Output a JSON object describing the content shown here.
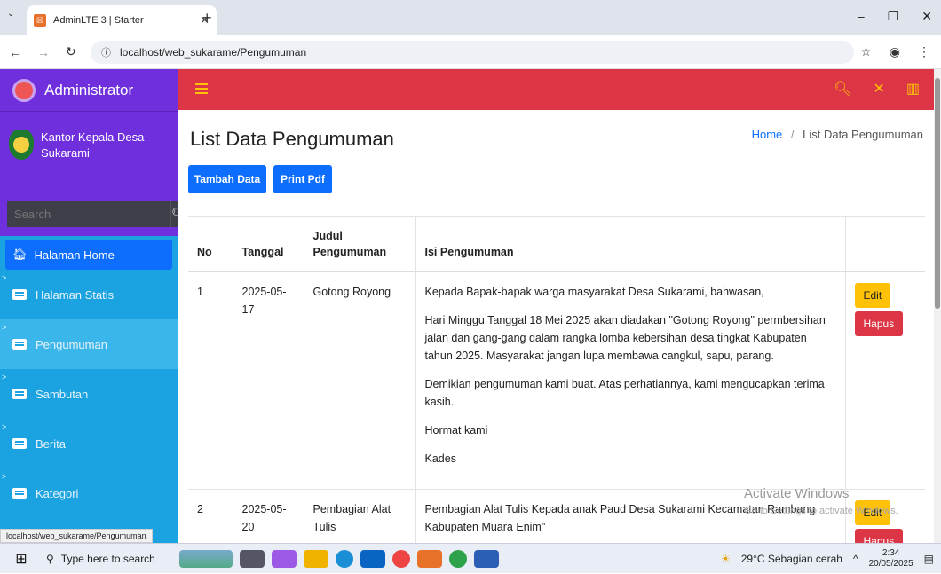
{
  "browser": {
    "tab_title": "AdminLTE 3 | Starter",
    "url": "localhost/web_sukarame/Pengumuman",
    "status_url": "localhost/web_sukarame/Pengumuman"
  },
  "sidebar": {
    "brand": "Administrator",
    "user": "Kantor Kepala Desa Sukarami",
    "search_placeholder": "Search",
    "items": [
      {
        "label": "Halaman Home",
        "icon": "home-icon"
      },
      {
        "label": "Halaman Statis",
        "icon": "list-icon"
      },
      {
        "label": "Pengumuman",
        "icon": "list-icon"
      },
      {
        "label": "Sambutan",
        "icon": "list-icon"
      },
      {
        "label": "Berita",
        "icon": "list-icon"
      },
      {
        "label": "Kategori",
        "icon": "list-icon"
      }
    ]
  },
  "page": {
    "title": "List Data Pengumuman",
    "breadcrumb_home": "Home",
    "breadcrumb_sep": "/",
    "breadcrumb_current": "List Data Pengumuman",
    "btn_add": "Tambah Data",
    "btn_print": "Print Pdf"
  },
  "table": {
    "headers": [
      "No",
      "Tanggal",
      "Judul Pengumuman",
      "Isi Pengumuman",
      ""
    ],
    "rows": [
      {
        "no": "1",
        "tanggal": "2025-05-17",
        "judul": "Gotong Royong",
        "isi": [
          "Kepada Bapak-bapak warga masyarakat Desa Sukarami, bahwasan,",
          "Hari Minggu Tanggal 18 Mei 2025 akan diadakan \"Gotong Royong\" permbersihan jalan dan gang-gang dalam rangka lomba kebersihan desa tingkat Kabupaten tahun 2025. Masyarakat jangan lupa membawa cangkul, sapu, parang.",
          "Demikian pengumuman kami buat. Atas perhatiannya, kami mengucapkan terima kasih.",
          "Hormat kami",
          "Kades"
        ]
      },
      {
        "no": "2",
        "tanggal": "2025-05-20",
        "judul": "Pembagian Alat Tulis",
        "isi": [
          "Pembagian Alat Tulis Kepada anak Paud Desa Sukarami Kecamatan Rambang Kabupaten Muara Enim\""
        ]
      }
    ],
    "btn_edit": "Edit",
    "btn_hapus": "Hapus"
  },
  "watermark": {
    "title": "Activate Windows",
    "sub": "Go to Settings to activate Windows."
  },
  "taskbar": {
    "search_placeholder": "Type here to search",
    "weather": "29°C  Sebagian cerah",
    "time": "2:34",
    "date": "20/05/2025"
  }
}
